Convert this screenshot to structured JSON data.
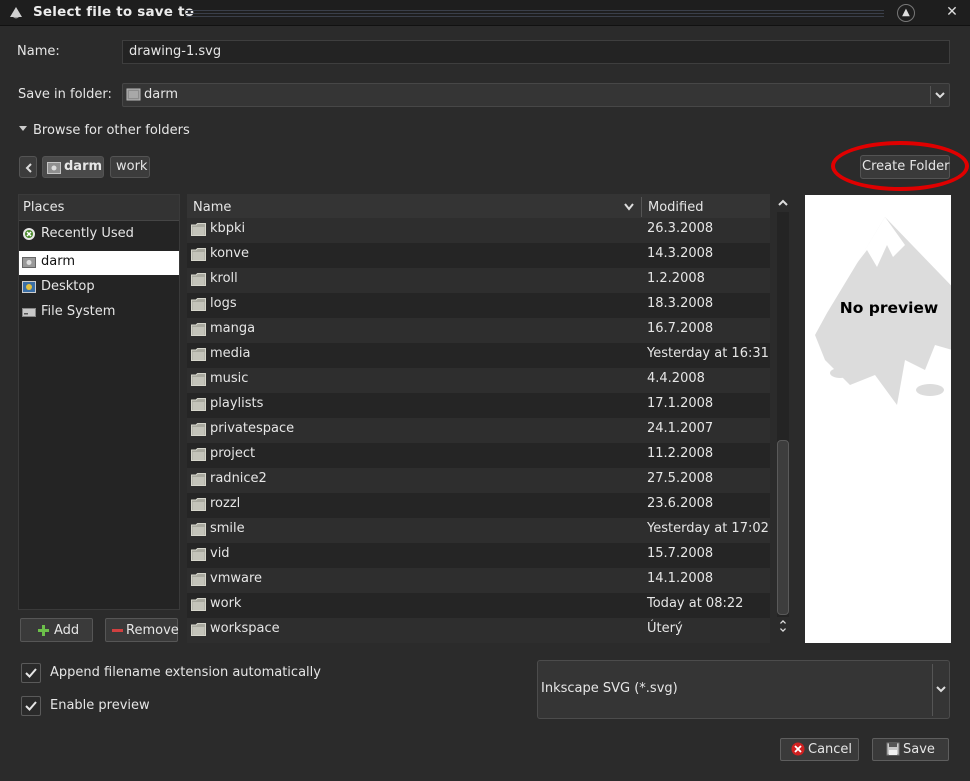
{
  "window": {
    "title": "Select file to save to"
  },
  "name": {
    "label": "Name:",
    "value": "drawing-1.svg"
  },
  "save_in": {
    "label": "Save in folder:",
    "value": "darm"
  },
  "browse": {
    "label": "Browse for other folders"
  },
  "pathbar": {
    "segments": [
      "darm",
      "work"
    ],
    "create_folder_label": "Create Folder"
  },
  "places": {
    "header": "Places",
    "items": [
      {
        "label": "Recently Used",
        "icon": "recent-icon"
      },
      {
        "label": "darm",
        "icon": "home-folder-icon",
        "selected": true
      },
      {
        "label": "Desktop",
        "icon": "desktop-icon"
      },
      {
        "label": "File System",
        "icon": "drive-icon"
      }
    ],
    "add_label": "Add",
    "remove_label": "Remove"
  },
  "files": {
    "col_name": "Name",
    "col_modified": "Modified",
    "rows": [
      {
        "name": "kbpki",
        "modified": "26.3.2008"
      },
      {
        "name": "konve",
        "modified": "14.3.2008"
      },
      {
        "name": "kroll",
        "modified": "1.2.2008"
      },
      {
        "name": "logs",
        "modified": "18.3.2008"
      },
      {
        "name": "manga",
        "modified": "16.7.2008"
      },
      {
        "name": "media",
        "modified": "Yesterday at 16:31"
      },
      {
        "name": "music",
        "modified": "4.4.2008"
      },
      {
        "name": "playlists",
        "modified": "17.1.2008"
      },
      {
        "name": "privatespace",
        "modified": "24.1.2007"
      },
      {
        "name": "project",
        "modified": "11.2.2008"
      },
      {
        "name": "radnice2",
        "modified": "27.5.2008"
      },
      {
        "name": "rozzl",
        "modified": "23.6.2008"
      },
      {
        "name": "smile",
        "modified": "Yesterday at 17:02"
      },
      {
        "name": "vid",
        "modified": "15.7.2008"
      },
      {
        "name": "vmware",
        "modified": "14.1.2008"
      },
      {
        "name": "work",
        "modified": "Today at 08:22"
      },
      {
        "name": "workspace",
        "modified": "Úterý"
      }
    ]
  },
  "preview": {
    "text": "No preview"
  },
  "options": {
    "append_extension": {
      "label": "Append filename extension automatically",
      "checked": true
    },
    "enable_preview": {
      "label": "Enable preview",
      "checked": true
    }
  },
  "filetype": {
    "value": "Inkscape SVG (*.svg)"
  },
  "actions": {
    "cancel_label": "Cancel",
    "save_label": "Save"
  },
  "colors": {
    "background": "#2b2b2b",
    "highlight_circle": "#e00000",
    "selection": "#ffffff"
  }
}
